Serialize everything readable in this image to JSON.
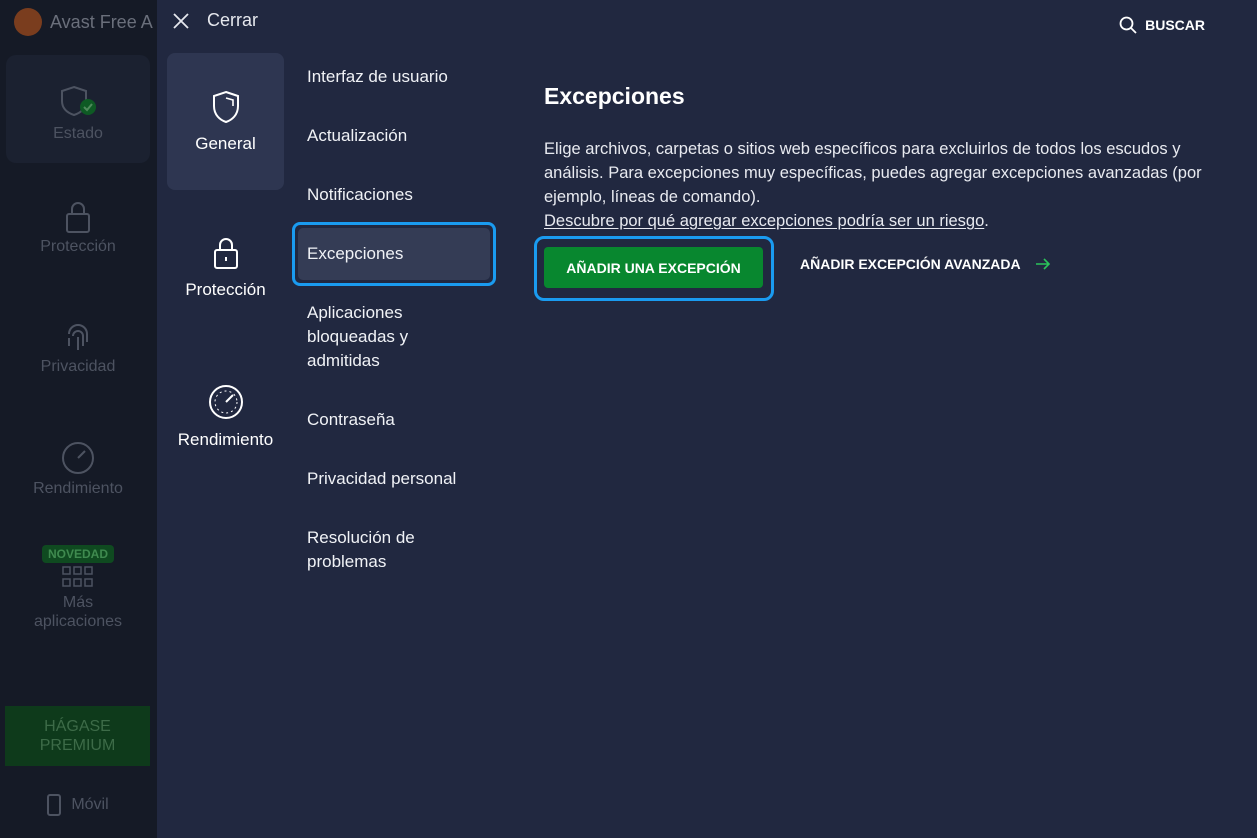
{
  "bg_app": {
    "title": "Avast Free A",
    "nav": [
      {
        "label": "Estado",
        "icon": "shield-check-icon"
      },
      {
        "label": "Protección",
        "icon": "lock-icon"
      },
      {
        "label": "Privacidad",
        "icon": "fingerprint-icon"
      },
      {
        "label": "Rendimiento",
        "icon": "gauge-icon"
      },
      {
        "label": "Más aplicaciones",
        "icon": "grid-icon",
        "badge": "NOVEDAD"
      }
    ],
    "premium_label": "HÁGASE PREMIUM",
    "mobile_label": "Móvil"
  },
  "header": {
    "close_label": "Cerrar",
    "search_label": "BUSCAR"
  },
  "categories": [
    {
      "label": "General",
      "icon": "shield-icon",
      "active": true
    },
    {
      "label": "Protección",
      "icon": "lock-icon",
      "active": false
    },
    {
      "label": "Rendimiento",
      "icon": "gauge-icon",
      "active": false
    }
  ],
  "subnav": [
    "Interfaz de usuario",
    "Actualización",
    "Notificaciones",
    "Excepciones",
    "Aplicaciones bloqueadas y admitidas",
    "Contraseña",
    "Privacidad personal",
    "Resolución de problemas"
  ],
  "subnav_selected": "Excepciones",
  "content": {
    "title": "Excepciones",
    "description": "Elige archivos, carpetas o sitios web específicos para excluirlos de todos los escudos y análisis. Para excepciones muy específicas, puedes agregar excepciones avanzadas (por ejemplo, líneas de comando).",
    "link_text": "Descubre por qué agregar excepciones podría ser un riesgo",
    "link_suffix": ".",
    "add_button": "AÑADIR UNA EXCEPCIÓN",
    "advanced_button": "AÑADIR EXCEPCIÓN AVANZADA"
  },
  "colors": {
    "accent_green": "#08872f",
    "highlight_blue": "#1a9bf0",
    "panel_bg": "#212840"
  }
}
